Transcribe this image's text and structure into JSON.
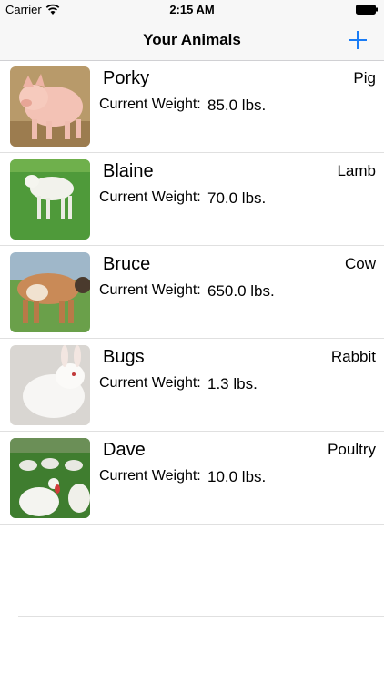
{
  "status_bar": {
    "carrier": "Carrier",
    "time": "2:15 AM",
    "icons": [
      "wifi-icon",
      "battery-icon"
    ]
  },
  "nav": {
    "title": "Your Animals",
    "add_icon": "plus-icon",
    "accent_color": "#1a7cf5"
  },
  "animals": [
    {
      "name": "Porky",
      "type": "Pig",
      "weight_label": "Current Weight:",
      "weight": "85.0 lbs."
    },
    {
      "name": "Blaine",
      "type": "Lamb",
      "weight_label": "Current Weight:",
      "weight": "70.0 lbs."
    },
    {
      "name": "Bruce",
      "type": "Cow",
      "weight_label": "Current Weight:",
      "weight": "650.0 lbs."
    },
    {
      "name": "Bugs",
      "type": "Rabbit",
      "weight_label": "Current Weight:",
      "weight": "1.3 lbs."
    },
    {
      "name": "Dave",
      "type": "Poultry",
      "weight_label": "Current Weight:",
      "weight": "10.0 lbs."
    }
  ]
}
